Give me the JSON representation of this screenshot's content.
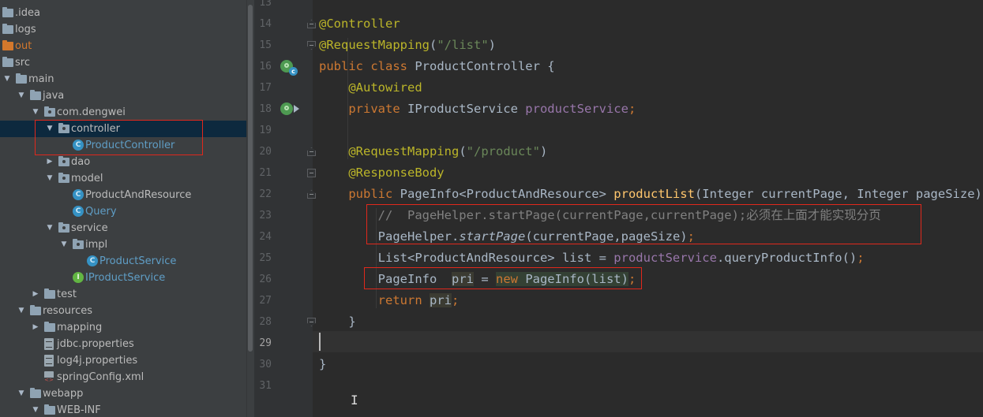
{
  "tree": {
    "items": [
      {
        "label": ".idea",
        "icon": "folder-icon"
      },
      {
        "label": "logs",
        "icon": "folder-icon"
      },
      {
        "label": "out",
        "icon": "folder-orange-icon"
      },
      {
        "label": "src",
        "icon": "folder-icon"
      },
      {
        "label": "main",
        "icon": "folder-icon"
      },
      {
        "label": "java",
        "icon": "source-folder-icon"
      },
      {
        "label": "com.dengwei",
        "icon": "package-icon"
      },
      {
        "label": "controller",
        "icon": "package-icon"
      },
      {
        "label": "ProductController",
        "icon": "class-icon"
      },
      {
        "label": "dao",
        "icon": "package-icon"
      },
      {
        "label": "model",
        "icon": "package-icon"
      },
      {
        "label": "ProductAndResource",
        "icon": "class-icon"
      },
      {
        "label": "Query",
        "icon": "class-icon"
      },
      {
        "label": "service",
        "icon": "package-icon"
      },
      {
        "label": "impl",
        "icon": "package-icon"
      },
      {
        "label": "ProductService",
        "icon": "class-icon"
      },
      {
        "label": "IProductService",
        "icon": "interface-icon"
      },
      {
        "label": "test",
        "icon": "folder-icon"
      },
      {
        "label": "resources",
        "icon": "resources-folder-icon"
      },
      {
        "label": "mapping",
        "icon": "folder-icon"
      },
      {
        "label": "jdbc.properties",
        "icon": "properties-file-icon"
      },
      {
        "label": "log4j.properties",
        "icon": "properties-file-icon"
      },
      {
        "label": "springConfig.xml",
        "icon": "xml-file-icon"
      },
      {
        "label": "webapp",
        "icon": "folder-icon"
      },
      {
        "label": "WEB-INF",
        "icon": "folder-icon"
      }
    ],
    "selected": "controller"
  },
  "editor": {
    "line_numbers": [
      "13",
      "14",
      "15",
      "16",
      "17",
      "18",
      "19",
      "20",
      "21",
      "22",
      "23",
      "24",
      "25",
      "26",
      "27",
      "28",
      "29",
      "30",
      "31"
    ],
    "current_line": "29",
    "lines": [
      [],
      [
        {
          "t": "@Controller",
          "c": "ann"
        }
      ],
      [
        {
          "t": "@RequestMapping",
          "c": "ann"
        },
        {
          "t": "(",
          "c": ""
        },
        {
          "t": "\"/list\"",
          "c": "str"
        },
        {
          "t": ")",
          "c": ""
        }
      ],
      [
        {
          "t": "public class ",
          "c": "kw"
        },
        {
          "t": "ProductController {",
          "c": ""
        }
      ],
      [
        {
          "t": "    ",
          "c": ""
        },
        {
          "t": "@Autowired",
          "c": "ann"
        }
      ],
      [
        {
          "t": "    ",
          "c": ""
        },
        {
          "t": "private ",
          "c": "kw"
        },
        {
          "t": "IProductService ",
          "c": ""
        },
        {
          "t": "productService",
          "c": "fld"
        },
        {
          "t": ";",
          "c": "kw"
        }
      ],
      [],
      [
        {
          "t": "    ",
          "c": ""
        },
        {
          "t": "@RequestMapping",
          "c": "ann"
        },
        {
          "t": "(",
          "c": ""
        },
        {
          "t": "\"/product\"",
          "c": "str"
        },
        {
          "t": ")",
          "c": ""
        }
      ],
      [
        {
          "t": "    ",
          "c": ""
        },
        {
          "t": "@ResponseBody",
          "c": "ann"
        }
      ],
      [
        {
          "t": "    ",
          "c": ""
        },
        {
          "t": "public ",
          "c": "kw"
        },
        {
          "t": "PageInfo<ProductAndResource> ",
          "c": ""
        },
        {
          "t": "productList",
          "c": "mth"
        },
        {
          "t": "(Integer currentPage, Integer pageSize){",
          "c": ""
        }
      ],
      [
        {
          "t": "        ",
          "c": ""
        },
        {
          "t": "//  PageHelper.startPage(currentPage,currentPage);必须在上面才能实现分页",
          "c": "cmt"
        }
      ],
      [
        {
          "t": "        PageHelper.",
          "c": ""
        },
        {
          "t": "startPage",
          "c": "ital"
        },
        {
          "t": "(currentPage,pageSize)",
          "c": ""
        },
        {
          "t": ";",
          "c": "kw"
        }
      ],
      [
        {
          "t": "        List<ProductAndResource> list = ",
          "c": ""
        },
        {
          "t": "productService",
          "c": "fld"
        },
        {
          "t": ".queryProductInfo()",
          "c": ""
        },
        {
          "t": ";",
          "c": "kw"
        }
      ],
      [
        {
          "t": "        PageInfo  ",
          "c": ""
        },
        {
          "t": "pri",
          "c": "hl"
        },
        {
          "t": " = ",
          "c": ""
        },
        {
          "t": "new ",
          "c": "kw hl2"
        },
        {
          "t": "PageInfo(list)",
          "c": "hl2"
        },
        {
          "t": ";",
          "c": "kw"
        }
      ],
      [
        {
          "t": "        ",
          "c": ""
        },
        {
          "t": "return ",
          "c": "kw"
        },
        {
          "t": "pri",
          "c": "hl"
        },
        {
          "t": ";",
          "c": "kw"
        }
      ],
      [
        {
          "t": "    }",
          "c": ""
        }
      ],
      [],
      [
        {
          "t": "}",
          "c": ""
        }
      ],
      []
    ]
  }
}
